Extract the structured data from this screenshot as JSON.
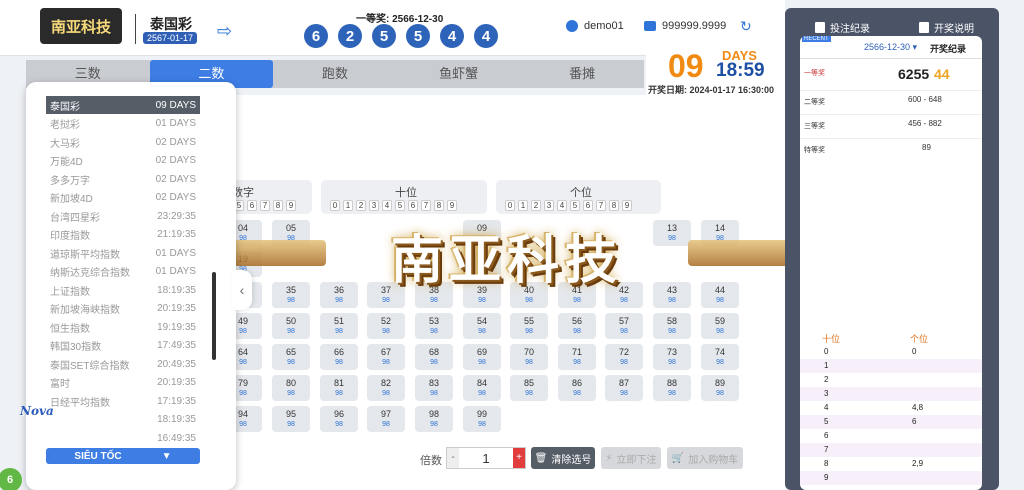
{
  "brand": {
    "logo_text": "南亚科技"
  },
  "header": {
    "lottery_name": "泰国彩",
    "lottery_date": "2567-01-17",
    "prize_label": "一等奖: 2566-12-30",
    "balls": [
      "6",
      "2",
      "5",
      "5",
      "4",
      "4"
    ],
    "username": "demo01",
    "balance": "999999.9999"
  },
  "tabs": [
    "三数",
    "二数",
    "跑数",
    "鱼虾蟹",
    "番摊"
  ],
  "active_tab": 1,
  "countdown": {
    "days": "09",
    "days_label": "DAYS",
    "time": "18:59",
    "open_date": "开奖日期: 2024-01-17 16:30:00"
  },
  "sidebar": {
    "items": [
      {
        "name": "泰国彩",
        "time": "09 DAYS"
      },
      {
        "name": "老挝彩",
        "time": "01 DAYS"
      },
      {
        "name": "大马彩",
        "time": "02 DAYS"
      },
      {
        "name": "万能4D",
        "time": "02 DAYS"
      },
      {
        "name": "多多万字",
        "time": "02 DAYS"
      },
      {
        "name": "新加坡4D",
        "time": "02 DAYS"
      },
      {
        "name": "台湾四星彩",
        "time": "23:29:35"
      },
      {
        "name": "印度指数",
        "time": "21:19:35"
      },
      {
        "name": "道琼斯平均指数",
        "time": "01 DAYS"
      },
      {
        "name": "纳斯达克综合指数",
        "time": "01 DAYS"
      },
      {
        "name": "上证指数",
        "time": "18:19:35"
      },
      {
        "name": "新加坡海峡指数",
        "time": "20:19:35"
      },
      {
        "name": "恒生指数",
        "time": "19:19:35"
      },
      {
        "name": "韩国30指数",
        "time": "17:49:35"
      },
      {
        "name": "泰国SET综合指数",
        "time": "20:49:35"
      },
      {
        "name": "富时",
        "time": "20:19:35"
      },
      {
        "name": "日经平均指数",
        "time": "17:19:35"
      },
      {
        "name": "",
        "time": "18:19:35"
      },
      {
        "name": "",
        "time": "16:49:35"
      }
    ],
    "button": "SIÊU TỐC"
  },
  "board": {
    "groups": [
      {
        "title": "数字"
      },
      {
        "title": "十位"
      },
      {
        "title": "个位"
      }
    ],
    "digits_left": [
      "5",
      "6",
      "7",
      "8",
      "9"
    ],
    "digits": [
      "0",
      "1",
      "2",
      "3",
      "4",
      "5",
      "6",
      "7",
      "8",
      "9"
    ],
    "cells": [
      {
        "n": "04",
        "o": "98"
      },
      {
        "n": "05",
        "o": "98"
      },
      {
        "n": "09",
        "o": "98"
      },
      {
        "n": "13",
        "o": "98"
      },
      {
        "n": "14",
        "o": "98"
      },
      {
        "n": "19",
        "o": "98"
      },
      {
        "n": "24",
        "o": "98"
      },
      {
        "n": "34",
        "o": "98"
      },
      {
        "n": "35",
        "o": "98"
      },
      {
        "n": "36",
        "o": "98"
      },
      {
        "n": "37",
        "o": "98"
      },
      {
        "n": "38",
        "o": "98"
      },
      {
        "n": "39",
        "o": "98"
      },
      {
        "n": "40",
        "o": "98"
      },
      {
        "n": "41",
        "o": "98"
      },
      {
        "n": "42",
        "o": "98"
      },
      {
        "n": "43",
        "o": "98"
      },
      {
        "n": "44",
        "o": "98"
      },
      {
        "n": "49",
        "o": "98"
      },
      {
        "n": "50",
        "o": "98"
      },
      {
        "n": "51",
        "o": "98"
      },
      {
        "n": "52",
        "o": "98"
      },
      {
        "n": "53",
        "o": "98"
      },
      {
        "n": "54",
        "o": "98"
      },
      {
        "n": "55",
        "o": "98"
      },
      {
        "n": "56",
        "o": "98"
      },
      {
        "n": "57",
        "o": "98"
      },
      {
        "n": "58",
        "o": "98"
      },
      {
        "n": "59",
        "o": "98"
      },
      {
        "n": "64",
        "o": "98"
      },
      {
        "n": "65",
        "o": "98"
      },
      {
        "n": "66",
        "o": "98"
      },
      {
        "n": "67",
        "o": "98"
      },
      {
        "n": "68",
        "o": "98"
      },
      {
        "n": "69",
        "o": "98"
      },
      {
        "n": "70",
        "o": "98"
      },
      {
        "n": "71",
        "o": "98"
      },
      {
        "n": "72",
        "o": "98"
      },
      {
        "n": "73",
        "o": "98"
      },
      {
        "n": "74",
        "o": "98"
      },
      {
        "n": "79",
        "o": "98"
      },
      {
        "n": "80",
        "o": "98"
      },
      {
        "n": "81",
        "o": "98"
      },
      {
        "n": "82",
        "o": "98"
      },
      {
        "n": "83",
        "o": "98"
      },
      {
        "n": "84",
        "o": "98"
      },
      {
        "n": "85",
        "o": "98"
      },
      {
        "n": "86",
        "o": "98"
      },
      {
        "n": "87",
        "o": "98"
      },
      {
        "n": "88",
        "o": "98"
      },
      {
        "n": "89",
        "o": "98"
      },
      {
        "n": "94",
        "o": "98"
      },
      {
        "n": "95",
        "o": "98"
      },
      {
        "n": "96",
        "o": "98"
      },
      {
        "n": "97",
        "o": "98"
      },
      {
        "n": "98",
        "o": "98"
      },
      {
        "n": "99",
        "o": "98"
      }
    ]
  },
  "watermark": "南亚科技",
  "bottom": {
    "multiplier_label": "倍数",
    "multiplier_value": "1",
    "minus": "-",
    "plus": "+",
    "clear": "清除选号",
    "confirm": "立即下注",
    "cart": "加入购物车"
  },
  "right": {
    "bet_record": "投注纪录",
    "rules": "开奖说明",
    "tag": "RECENT",
    "date": "2566-12-30",
    "record_title": "开奖纪录",
    "first_label": "一等奖",
    "first_main": "6255",
    "first_tail": "44",
    "rows": [
      {
        "label": "二等奖",
        "value": "600 - 648"
      },
      {
        "label": "三等奖",
        "value": "456 - 882"
      },
      {
        "label": "特等奖",
        "value": "89"
      }
    ],
    "stats_head": {
      "tens": "十位",
      "units": "个位"
    },
    "stats": [
      {
        "d": "0",
        "v": "0"
      },
      {
        "d": "1",
        "v": ""
      },
      {
        "d": "2",
        "v": ""
      },
      {
        "d": "3",
        "v": ""
      },
      {
        "d": "4",
        "v": "4,8"
      },
      {
        "d": "5",
        "v": "6"
      },
      {
        "d": "6",
        "v": ""
      },
      {
        "d": "7",
        "v": ""
      },
      {
        "d": "8",
        "v": "2,9"
      },
      {
        "d": "9",
        "v": ""
      }
    ]
  },
  "badge": "6",
  "corner_logo": "Nova"
}
